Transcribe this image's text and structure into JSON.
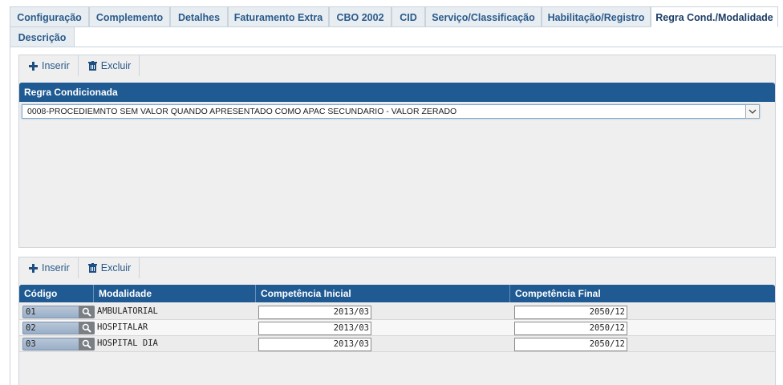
{
  "tabs": [
    {
      "label": "Configuração",
      "active": false
    },
    {
      "label": "Complemento",
      "active": false
    },
    {
      "label": "Detalhes",
      "active": false
    },
    {
      "label": "Faturamento Extra",
      "active": false
    },
    {
      "label": "CBO 2002",
      "active": false
    },
    {
      "label": "CID",
      "active": false
    },
    {
      "label": "Serviço/Classificação",
      "active": false
    },
    {
      "label": "Habilitação/Registro",
      "active": false
    },
    {
      "label": "Regra Cond./Modalidade",
      "active": true
    },
    {
      "label": "Descrição",
      "active": false
    }
  ],
  "regra_panel": {
    "insert_label": "Inserir",
    "delete_label": "Excluir",
    "header": "Regra Condicionada",
    "select_value": "0008-PROCEDIEMNTO SEM VALOR QUANDO APRESENTADO COMO APAC SECUNDARIO - VALOR ZERADO"
  },
  "modalidade_panel": {
    "insert_label": "Inserir",
    "delete_label": "Excluir",
    "columns": [
      "Código",
      "Modalidade",
      "Competência Inicial",
      "Competência Final"
    ],
    "rows": [
      {
        "codigo": "01",
        "modalidade": "AMBULATORIAL",
        "inicial": "2013/03",
        "final": "2050/12"
      },
      {
        "codigo": "02",
        "modalidade": "HOSPITALAR",
        "inicial": "2013/03",
        "final": "2050/12"
      },
      {
        "codigo": "03",
        "modalidade": "HOSPITAL DIA",
        "inicial": "2013/03",
        "final": "2050/12"
      }
    ]
  },
  "colors": {
    "accent": "#1f5a93",
    "tab_text": "#2a5a8a",
    "panel_bg": "#efefef"
  }
}
